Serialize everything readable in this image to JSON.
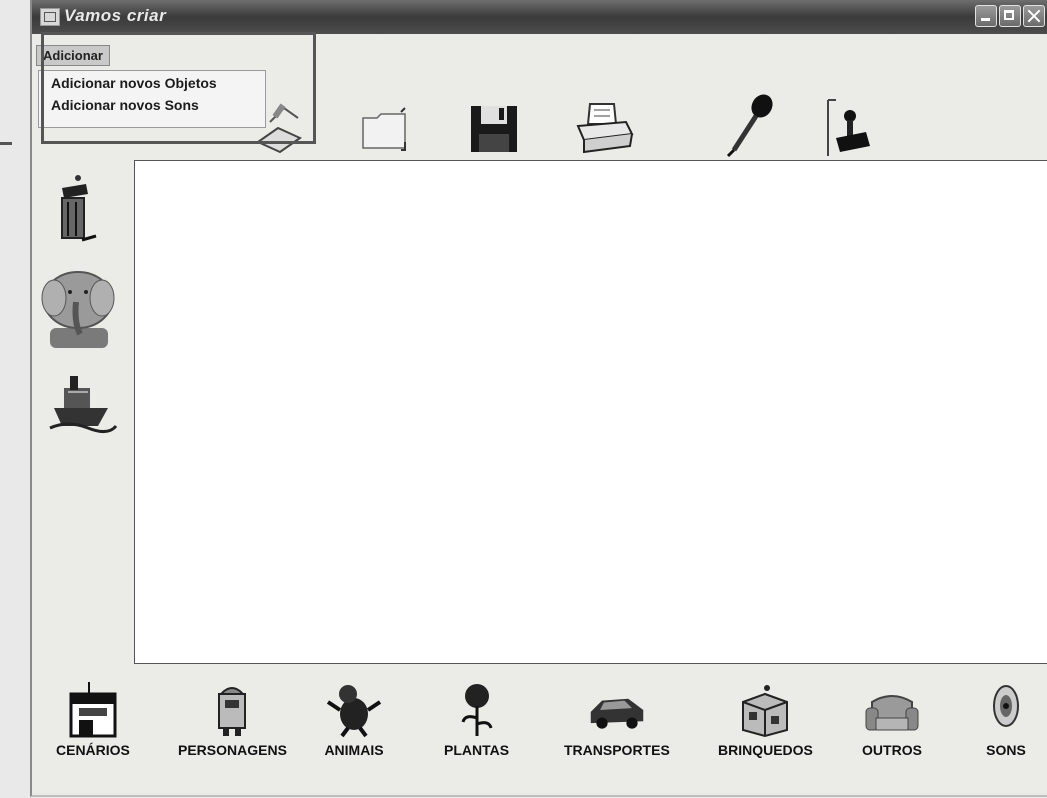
{
  "window": {
    "title": "Vamos criar",
    "buttons": [
      "minimize",
      "maximize",
      "close"
    ]
  },
  "menu": {
    "title": "Adicionar",
    "items": [
      {
        "label": "Adicionar novos Objetos"
      },
      {
        "label": "Adicionar novos Sons"
      }
    ]
  },
  "toolbar": {
    "icons": [
      "new-document-icon",
      "open-folder-icon",
      "save-disk-icon",
      "printer-icon",
      "microphone-icon",
      "joystick-icon"
    ]
  },
  "sidebar": {
    "icons": [
      "trash-can-icon",
      "elephant-icon",
      "ship-icon"
    ]
  },
  "categories": [
    {
      "label": "CENÁRIOS",
      "icon": "building-icon"
    },
    {
      "label": "PERSONAGENS",
      "icon": "robot-icon"
    },
    {
      "label": "ANIMAIS",
      "icon": "animal-icon"
    },
    {
      "label": "PLANTAS",
      "icon": "rose-icon"
    },
    {
      "label": "TRANSPORTES",
      "icon": "car-icon"
    },
    {
      "label": "BRINQUEDOS",
      "icon": "toy-box-icon"
    },
    {
      "label": "OUTROS",
      "icon": "armchair-icon"
    },
    {
      "label": "SONS",
      "icon": "speaker-icon"
    }
  ]
}
